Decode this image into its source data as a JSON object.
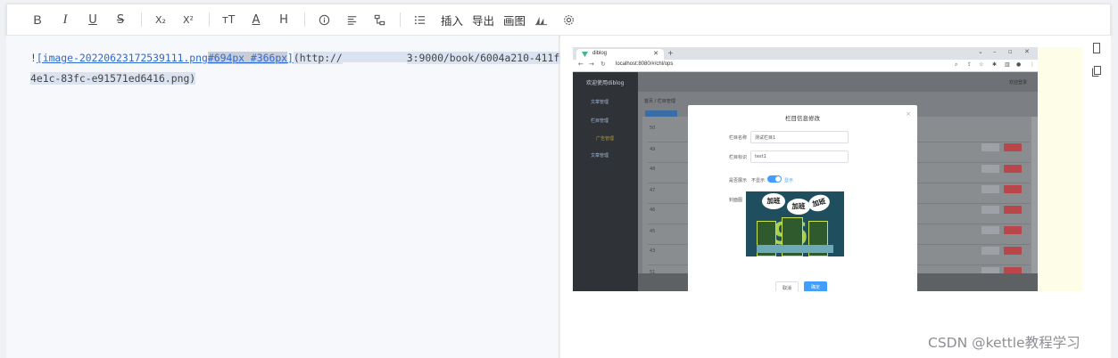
{
  "toolbar": {
    "items": [
      {
        "name": "bold-button",
        "glyph": "B"
      },
      {
        "name": "italic-button",
        "glyph": "I"
      },
      {
        "name": "underline-button",
        "glyph": "U"
      },
      {
        "name": "strikethrough-button",
        "glyph": "S"
      },
      {
        "name": "subscript-button",
        "glyph": "X₂"
      },
      {
        "name": "superscript-button",
        "glyph": "X²"
      },
      {
        "name": "font-size-button",
        "glyph": "тT"
      },
      {
        "name": "font-color-button",
        "glyph": "A"
      },
      {
        "name": "heading-button",
        "glyph": "H"
      }
    ],
    "insert_label": "插入",
    "export_label": "导出",
    "draw_label": "画图"
  },
  "editor": {
    "line1_prefix": "!",
    "line1_link_name": "[image-20220623172539111.png",
    "line1_link_size": "#694px #366px",
    "line1_link_end": "]",
    "line1_url_start": "(http://",
    "line1_url_end": "3:9000/book/6004a210-411f-",
    "line2": "4e1c-83fc-e91571ed6416.png)"
  },
  "screenshot": {
    "tab_title": "diblog",
    "url": "localhost:8080/#/chl/ops",
    "app_title": "欢迎使用diblog",
    "top_right": "欢迎登录",
    "menu": [
      "文章管理",
      "栏目管理",
      "广告管理",
      "文章管理"
    ],
    "crumb": "首页 / 栏目管理",
    "rows": [
      "50",
      "49",
      "48",
      "47",
      "46",
      "45",
      "43",
      "51"
    ],
    "edit_label": "编辑",
    "delete_label": "删除",
    "dialog": {
      "title": "栏目信息修改",
      "name_label": "栏目名称",
      "name_value": "测试栏目1",
      "code_label": "栏目标识",
      "code_value": "test1",
      "show_label": "是否展示",
      "switch_off": "不显示",
      "switch_on": "显示",
      "cover_label": "封面图",
      "bubbles": [
        "加班",
        "加班",
        "加班"
      ],
      "cover_number": "996",
      "cancel": "取消",
      "confirm": "确定"
    }
  },
  "watermark": "CSDN @kettle教程学习"
}
